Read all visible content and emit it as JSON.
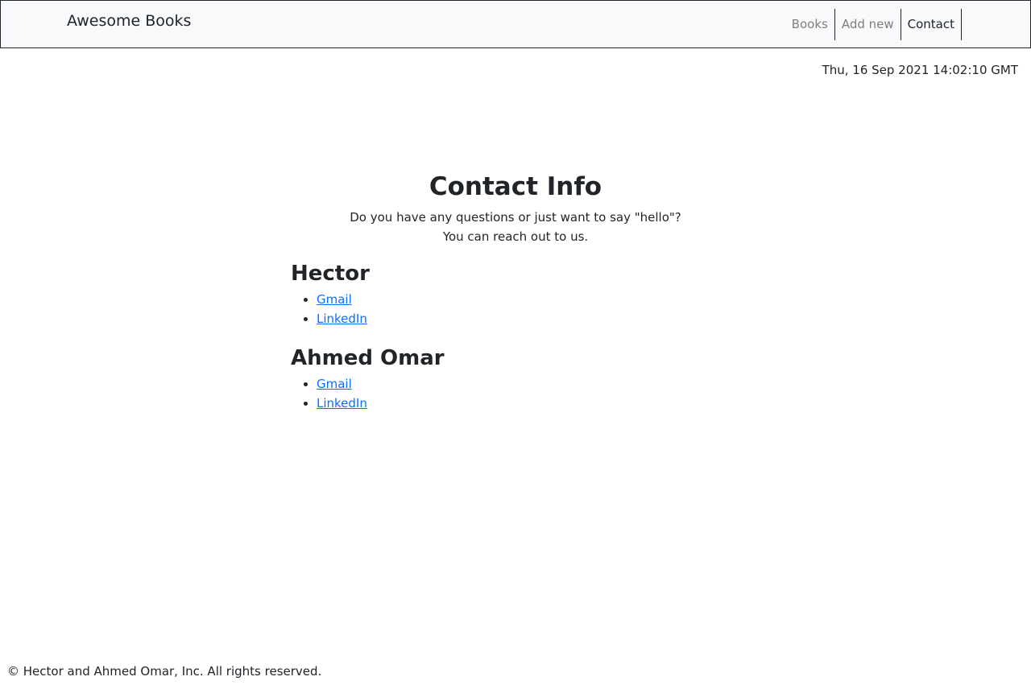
{
  "nav": {
    "brand": "Awesome Books",
    "items": [
      "Books",
      "Add new",
      "Contact"
    ]
  },
  "date": "Thu, 16 Sep 2021 14:02:10 GMT",
  "contact": {
    "title": "Contact Info",
    "intro_line1": "Do you have any questions or just want to say \"hello\"?",
    "intro_line2": "You can reach out to us.",
    "people": [
      {
        "name": "Hector",
        "links": [
          "Gmail",
          "LinkedIn"
        ]
      },
      {
        "name": "Ahmed Omar",
        "links": [
          "Gmail",
          "LinkedIn"
        ]
      }
    ]
  },
  "footer": "© Hector and Ahmed Omar, Inc. All rights reserved.",
  "colors": {
    "navbar_bg": "#f8f9fa",
    "text": "#212529",
    "nav_inactive": "#7c7e80",
    "link": "#0d6efd"
  }
}
